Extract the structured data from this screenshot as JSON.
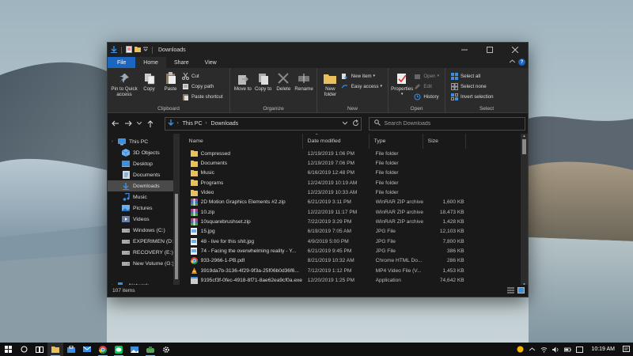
{
  "window": {
    "title": "Downloads",
    "controls": [
      "minimize-icon",
      "maximize-icon",
      "close-icon"
    ]
  },
  "ribbon": {
    "tabs": [
      {
        "label": "File",
        "kind": "file"
      },
      {
        "label": "Home",
        "kind": "active"
      },
      {
        "label": "Share",
        "kind": ""
      },
      {
        "label": "View",
        "kind": ""
      }
    ],
    "clipboard": {
      "pin_label": "Pin to Quick access",
      "copy_label": "Copy",
      "paste_label": "Paste",
      "cut_label": "Cut",
      "copy_path_label": "Copy path",
      "paste_shortcut_label": "Paste shortcut",
      "group_label": "Clipboard"
    },
    "organize": {
      "move_to_label": "Move to",
      "copy_to_label": "Copy to",
      "delete_label": "Delete",
      "rename_label": "Rename",
      "group_label": "Organize"
    },
    "new": {
      "new_folder_label": "New folder",
      "new_item_label": "New item",
      "easy_access_label": "Easy access",
      "group_label": "New"
    },
    "open": {
      "properties_label": "Properties",
      "open_label": "Open",
      "edit_label": "Edit",
      "history_label": "History",
      "group_label": "Open"
    },
    "select": {
      "select_all_label": "Select all",
      "select_none_label": "Select none",
      "invert_selection_label": "Invert selection",
      "group_label": "Select"
    }
  },
  "address": {
    "crumbs": [
      "This PC",
      "Downloads"
    ],
    "search_placeholder": "Search Downloads"
  },
  "nav": {
    "items": [
      {
        "label": "This PC",
        "icon": "computer-icon",
        "level": 0,
        "selected": false
      },
      {
        "label": "3D Objects",
        "icon": "cube-icon",
        "level": 1,
        "selected": false
      },
      {
        "label": "Desktop",
        "icon": "desktop-icon",
        "level": 1,
        "selected": false
      },
      {
        "label": "Documents",
        "icon": "document-icon",
        "level": 1,
        "selected": false
      },
      {
        "label": "Downloads",
        "icon": "download-icon",
        "level": 1,
        "selected": true
      },
      {
        "label": "Music",
        "icon": "music-icon",
        "level": 1,
        "selected": false
      },
      {
        "label": "Pictures",
        "icon": "picture-icon",
        "level": 1,
        "selected": false
      },
      {
        "label": "Videos",
        "icon": "video-icon",
        "level": 1,
        "selected": false
      },
      {
        "label": "Windows (C:)",
        "icon": "drive-icon",
        "level": 1,
        "selected": false
      },
      {
        "label": "EXPERIMEN (D:)",
        "icon": "drive-icon",
        "level": 1,
        "selected": false
      },
      {
        "label": "RECOVERY (E:)",
        "icon": "drive-icon",
        "level": 1,
        "selected": false
      },
      {
        "label": "New Volume (G:)",
        "icon": "drive-icon",
        "level": 1,
        "selected": false
      },
      {
        "label": "",
        "icon": "",
        "level": 0,
        "selected": false
      },
      {
        "label": "Network",
        "icon": "network-icon",
        "level": 0,
        "selected": false
      }
    ]
  },
  "files": {
    "columns": {
      "name": "Name",
      "date": "Date modified",
      "type": "Type",
      "size": "Size"
    },
    "rows": [
      {
        "name": "Compressed",
        "date": "12/19/2019 1:06 PM",
        "type": "File folder",
        "size": "",
        "icon": "folder-icon"
      },
      {
        "name": "Documents",
        "date": "12/19/2019 7:06 PM",
        "type": "File folder",
        "size": "",
        "icon": "folder-icon"
      },
      {
        "name": "Music",
        "date": "6/16/2019 12:48 PM",
        "type": "File folder",
        "size": "",
        "icon": "folder-icon"
      },
      {
        "name": "Programs",
        "date": "12/24/2019 10:19 AM",
        "type": "File folder",
        "size": "",
        "icon": "folder-icon"
      },
      {
        "name": "Video",
        "date": "12/23/2019 10:33 AM",
        "type": "File folder",
        "size": "",
        "icon": "folder-icon"
      },
      {
        "name": "2D Motion Graphics Elements #2.zip",
        "date": "6/21/2019 3:11 PM",
        "type": "WinRAR ZIP archive",
        "size": "1,600 KB",
        "icon": "winrar-icon"
      },
      {
        "name": "10.zip",
        "date": "12/22/2019 11:17 PM",
        "type": "WinRAR ZIP archive",
        "size": "18,473 KB",
        "icon": "winrar-icon"
      },
      {
        "name": "10squarebrushset.zip",
        "date": "7/22/2019 3:29 PM",
        "type": "WinRAR ZIP archive",
        "size": "1,428 KB",
        "icon": "winrar-icon"
      },
      {
        "name": "15.jpg",
        "date": "6/19/2019 7:05 AM",
        "type": "JPG File",
        "size": "12,103 KB",
        "icon": "image-file-icon"
      },
      {
        "name": "48 - live for this shit.jpg",
        "date": "4/9/2019 5:00 PM",
        "type": "JPG File",
        "size": "7,800 KB",
        "icon": "image-file-icon"
      },
      {
        "name": "74 - Facing the overwhelming reality - Y...",
        "date": "6/21/2019 9:45 PM",
        "type": "JPG File",
        "size": "386 KB",
        "icon": "image-file-icon"
      },
      {
        "name": "933-2966-1-PB.pdf",
        "date": "8/21/2019 10:32 AM",
        "type": "Chrome HTML Do...",
        "size": "286 KB",
        "icon": "chrome-icon"
      },
      {
        "name": "3919da7b-3136-4f29-9f3a-25f06b0d36f6...",
        "date": "7/12/2019 1:12 PM",
        "type": "MP4 Video File (V...",
        "size": "1,453 KB",
        "icon": "vlc-icon"
      },
      {
        "name": "9195cf3f-0fec-4918-8f71-8ae62ea9cf0a.exe",
        "date": "12/20/2019 1:25 PM",
        "type": "Application",
        "size": "74,642 KB",
        "icon": "exe-icon"
      },
      {
        "name": "11794-23383-1-SM.pdf",
        "date": "7/22/2019 10:11 PM",
        "type": "Chrome HTML Do...",
        "size": "1,234 KB",
        "icon": "chrome-icon"
      }
    ]
  },
  "status": {
    "items_count": "107 items"
  },
  "taskbar": {
    "time": "10:19 AM",
    "apps": [
      "windows-start-icon",
      "search-icon",
      "task-view-icon",
      "file-explorer-icon",
      "store-icon",
      "mail-icon",
      "chrome-icon",
      "line-icon",
      "photos-icon",
      "xbox-icon",
      "settings-icon"
    ]
  },
  "colors": {
    "accent": "#1a66c2",
    "window_bg": "#191919",
    "ribbon_bg": "#2b2b2b",
    "selection": "#4a4a4a",
    "folder": "#e8c15a"
  }
}
